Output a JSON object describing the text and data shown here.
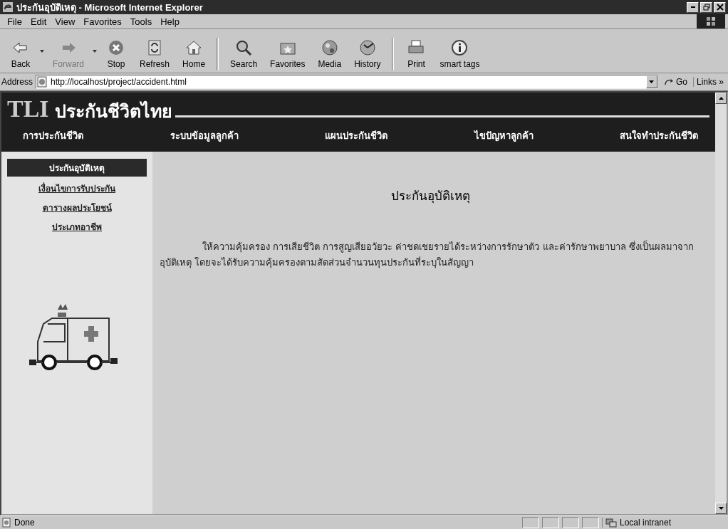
{
  "window": {
    "title": "ประกันอุบัติเหตุ - Microsoft Internet Explorer"
  },
  "menu": [
    "File",
    "Edit",
    "View",
    "Favorites",
    "Tools",
    "Help"
  ],
  "toolbar": [
    {
      "kind": "back",
      "label": "Back",
      "disabled": false,
      "dropdown": true
    },
    {
      "kind": "forward",
      "label": "Forward",
      "disabled": true,
      "dropdown": true
    },
    {
      "kind": "stop",
      "label": "Stop",
      "disabled": false,
      "dropdown": false
    },
    {
      "kind": "refresh",
      "label": "Refresh",
      "disabled": false,
      "dropdown": false
    },
    {
      "kind": "home",
      "label": "Home",
      "disabled": false,
      "dropdown": false
    },
    {
      "kind": "search",
      "label": "Search",
      "disabled": false,
      "dropdown": false
    },
    {
      "kind": "favorites",
      "label": "Favorites",
      "disabled": false,
      "dropdown": false
    },
    {
      "kind": "media",
      "label": "Media",
      "disabled": false,
      "dropdown": false
    },
    {
      "kind": "history",
      "label": "History",
      "disabled": false,
      "dropdown": false
    },
    {
      "kind": "print",
      "label": "Print",
      "disabled": false,
      "dropdown": false
    },
    {
      "kind": "info",
      "label": "smart tags",
      "disabled": false,
      "dropdown": false
    }
  ],
  "address_bar": {
    "label": "Address",
    "value": "http://localhost/project/accident.html",
    "go": "Go",
    "links": "Links",
    "links_chevron": "»"
  },
  "site": {
    "logo_latin": "TLI",
    "logo_thai": "ประกันชีวิตไทย",
    "nav": [
      "การประกันชีวิต",
      "ระบบข้อมูลลูกค้า",
      "แผนประกันชีวิต",
      "ไขปัญหาลูกค้า",
      "สนใจทำประกันชีวิต"
    ],
    "sidebar": {
      "items": [
        {
          "label": "ประกันอุบัติเหตุ",
          "selected": true
        },
        {
          "label": "เงื่อนไขการรับประกัน",
          "selected": false
        },
        {
          "label": "ตารางผลประโยชน์",
          "selected": false
        },
        {
          "label": "ประเภทอาชีพ",
          "selected": false
        }
      ]
    },
    "heading": "ประกันอุบัติเหตุ",
    "paragraph": "ให้ความคุ้มครอง การเสียชีวิต การสูญเสียอวัยวะ ค่าชดเชยรายได้ระหว่างการรักษาตัว และค่ารักษาพยาบาล ซึ่งเป็นผลมาจากอุบัติเหตุ โดยจะได้รับความคุ้มครองตามสัดส่วนจำนวนทุนประกันที่ระบุในสัญญา"
  },
  "status_bar": {
    "text": "Done",
    "zone": "Local intranet"
  }
}
